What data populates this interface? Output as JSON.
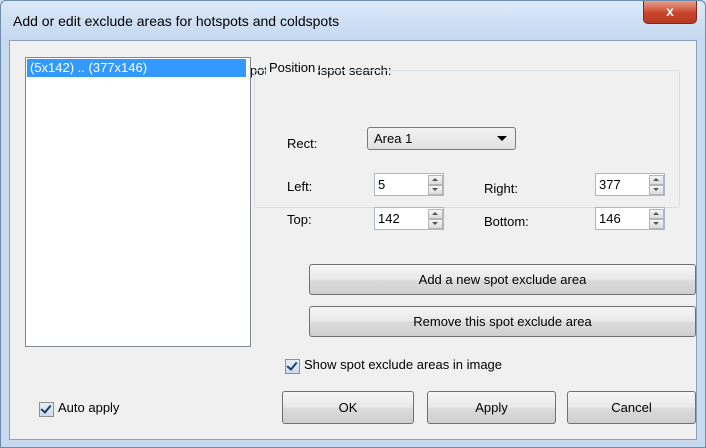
{
  "window": {
    "title": "Add or edit exclude areas for hotspots and coldspots",
    "close_glyph": "x"
  },
  "description": "This areas will be excluded from hotspot and coldspot search:",
  "areas_list": {
    "items": [
      "(5x142) .. (377x146)"
    ],
    "selected_index": 0
  },
  "position_group": {
    "label": "Position",
    "rect_label": "Rect:",
    "rect_value": "Area 1",
    "left_label": "Left:",
    "left_value": "5",
    "right_label": "Right:",
    "right_value": "377",
    "top_label": "Top:",
    "top_value": "142",
    "bottom_label": "Bottom:",
    "bottom_value": "146"
  },
  "buttons": {
    "add": "Add a new spot exclude area",
    "remove": "Remove this spot exclude area",
    "ok": "OK",
    "apply": "Apply",
    "cancel": "Cancel"
  },
  "checkboxes": {
    "show_areas": {
      "label": "Show spot exclude areas in image",
      "checked": true
    },
    "auto_apply": {
      "label": "Auto apply",
      "checked": true
    }
  },
  "colors": {
    "selection": "#3399ff",
    "close_button": "#c8442a",
    "dialog_face": "#f0f0f0"
  }
}
